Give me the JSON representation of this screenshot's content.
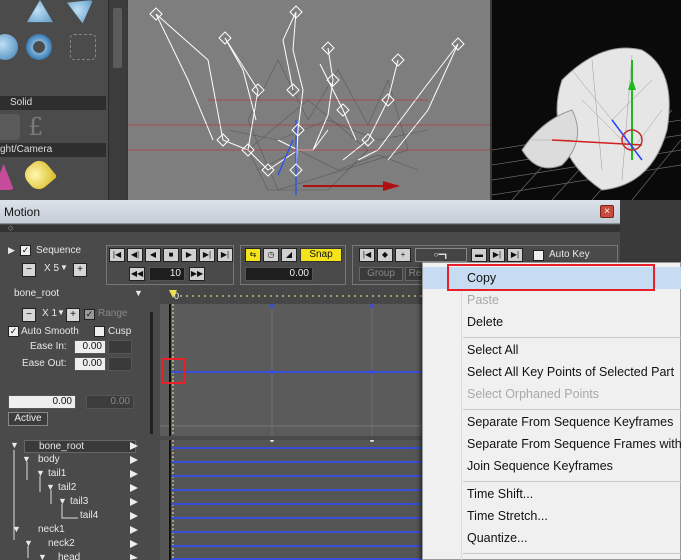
{
  "palette": {
    "sections": [
      "Solid",
      "ght/Camera"
    ]
  },
  "motion": {
    "title": "Motion",
    "close_icon": "×",
    "sequence_label": "Sequence",
    "sequence_checked": "✓",
    "x5_label": "X 5",
    "frame_step": "10",
    "snap_label": "Snap",
    "snap_value": "0.00",
    "group_label": "Group",
    "re_label": "Re",
    "autokey_label": "Auto Key",
    "bone_selected": "bone_root",
    "x1_label": "X 1",
    "range_label": "Range",
    "auto_smooth_label": "Auto Smooth",
    "cusp_label": "Cusp",
    "ease_in_label": "Ease In:",
    "ease_in_value": "0.00",
    "ease_out_label": "Ease Out:",
    "ease_out_value": "0.00",
    "value_left": "0.00",
    "value_right": "0.00",
    "active_label": "Active",
    "ruler_zero": "0",
    "tracks": [
      {
        "label": "bone_root",
        "indent": 0
      },
      {
        "label": "body",
        "indent": 1
      },
      {
        "label": "tail1",
        "indent": 2
      },
      {
        "label": "tail2",
        "indent": 3
      },
      {
        "label": "tail3",
        "indent": 4
      },
      {
        "label": "tail4",
        "indent": 5
      },
      {
        "label": "neck1",
        "indent": 1
      },
      {
        "label": "neck2",
        "indent": 2
      },
      {
        "label": "head",
        "indent": 3
      }
    ]
  },
  "context_menu": {
    "items": [
      {
        "label": "Copy",
        "disabled": false,
        "highlighted": true
      },
      {
        "label": "Paste",
        "disabled": true
      },
      {
        "label": "Delete",
        "disabled": false
      },
      {
        "label": "Select All",
        "disabled": false
      },
      {
        "label": "Select All Key Points of Selected Part",
        "disabled": false
      },
      {
        "label": "Select Orphaned Points",
        "disabled": true
      },
      {
        "label": "Separate From Sequence Keyframes",
        "disabled": false
      },
      {
        "label": "Separate From Sequence Frames with",
        "disabled": false
      },
      {
        "label": "Join Sequence Keyframes",
        "disabled": false
      },
      {
        "label": "Time Shift...",
        "disabled": false
      },
      {
        "label": "Time Stretch...",
        "disabled": false
      },
      {
        "label": "Quantize...",
        "disabled": false
      }
    ]
  },
  "colors": {
    "highlight_box": "#e8202a",
    "snap_yellow": "#f4e21a",
    "curve_blue": "#3a4fd8"
  }
}
